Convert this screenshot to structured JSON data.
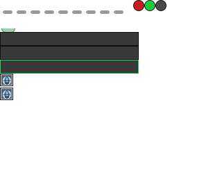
{
  "toolbar": {
    "indicators": [
      "indicator-1",
      "indicator-2",
      "indicator-3",
      "indicator-4",
      "indicator-5",
      "indicator-6",
      "indicator-7",
      "indicator-8",
      "indicator-9"
    ],
    "indicator_color": "#9a9a9a"
  },
  "window_controls": [
    {
      "name": "red-dot",
      "color": "#c81e1e"
    },
    {
      "name": "green-dot",
      "color": "#1ecc3a"
    },
    {
      "name": "gray-dot",
      "color": "#4a4a4a"
    }
  ],
  "panels": [
    {
      "name": "panel-1",
      "active": false
    },
    {
      "name": "panel-2",
      "active": false
    },
    {
      "name": "panel-3",
      "active": true
    }
  ],
  "tiles": [
    {
      "name": "record-tile-1",
      "icon": "globe-icon"
    },
    {
      "name": "record-tile-2",
      "icon": "globe-icon"
    }
  ],
  "colors": {
    "panel_bg": "#383838",
    "active_border": "#1ed760",
    "tile_bg": "#4a5f74"
  }
}
